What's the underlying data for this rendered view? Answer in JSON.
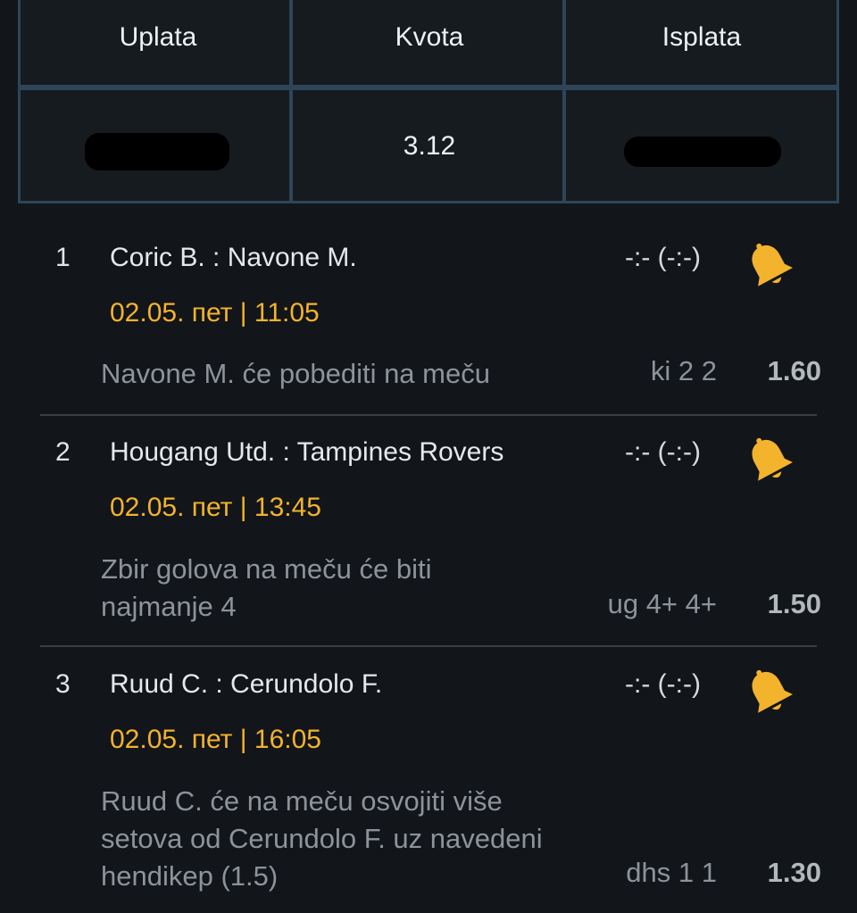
{
  "summary": {
    "headers": [
      "Uplata",
      "Kvota",
      "Isplata"
    ],
    "stake": "",
    "odds": "3.12",
    "payout": ""
  },
  "bets": [
    {
      "number": "1",
      "match": "Coric B. : Navone M.",
      "score": "-:- (-:-)",
      "date": "02.05. пет | 11:05",
      "description": "Navone M. će pobediti na meču",
      "code": "ki 2 2",
      "odd": "1.60",
      "icon": "bell-icon"
    },
    {
      "number": "2",
      "match": "Hougang Utd. : Tampines Rovers",
      "score": "-:- (-:-)",
      "date": "02.05. пет | 13:45",
      "description": "Zbir golova na meču će biti najmanje 4",
      "code": "ug 4+ 4+",
      "odd": "1.50",
      "icon": "bell-icon"
    },
    {
      "number": "3",
      "match": "Ruud C. : Cerundolo F.",
      "score": "-:- (-:-)",
      "date": "02.05. пет | 16:05",
      "description": "Ruud C. će na meču osvojiti više setova od Cerundolo F. uz navedeni hendikep (1.5)",
      "code": "dhs 1 1",
      "odd": "1.30",
      "icon": "bell-icon"
    }
  ],
  "colors": {
    "background": "#121519",
    "accent": "#f3b32d",
    "border": "#2e4559"
  }
}
